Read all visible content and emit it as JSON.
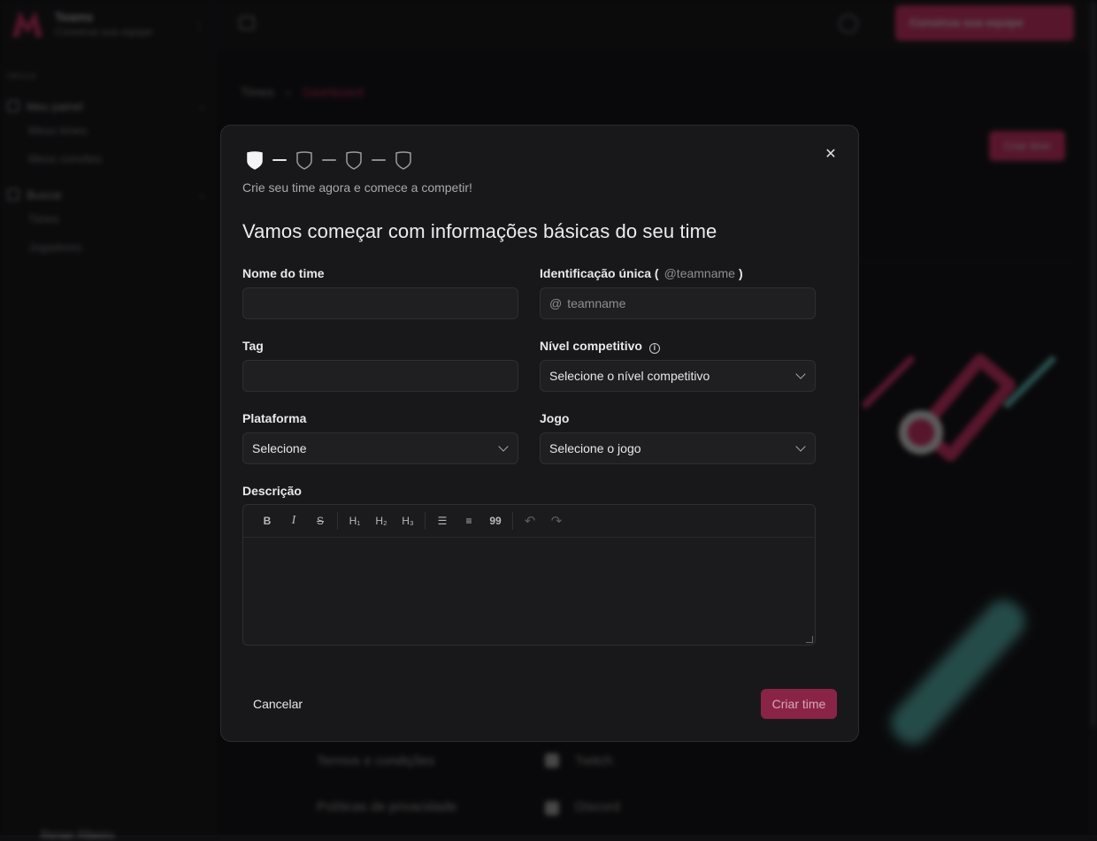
{
  "background": {
    "brand": {
      "title": "Teams",
      "subtitle": "Construa sua equipe"
    },
    "menu_label": "Menus",
    "menu_groups": [
      {
        "title": "Meu painel",
        "items": [
          "Meus times",
          "Meus convites"
        ]
      },
      {
        "title": "Buscar",
        "items": [
          "Times",
          "Jogadores"
        ]
      }
    ],
    "top_cta": "Construa sua equipe",
    "breadcrumb": [
      "Times",
      "Dashboard"
    ],
    "right_cta": "Criar time",
    "footer_links": [
      "Termos e condições",
      "Políticas de privacidade"
    ],
    "social_links": [
      "Twitch",
      "Discord"
    ],
    "user_name": "Renan Ribeiro"
  },
  "modal": {
    "subtitle": "Crie seu time agora e comece a competir!",
    "heading": "Vamos começar com informações básicas do seu time",
    "steps": [
      "step-1",
      "step-2",
      "step-3",
      "step-4"
    ],
    "fields": {
      "team_name": {
        "label": "Nome do time",
        "value": ""
      },
      "unique_id": {
        "label": "Identificação única (",
        "label_hint": "@teamname",
        "label_end": ")",
        "prefix": "@",
        "placeholder": "teamname"
      },
      "tag": {
        "label": "Tag",
        "value": ""
      },
      "competitive_level": {
        "label": "Nível competitivo",
        "value": "Selecione o nível competitivo"
      },
      "platform": {
        "label": "Plataforma",
        "value": "Selecione"
      },
      "game": {
        "label": "Jogo",
        "value": "Selecione o jogo"
      },
      "description": {
        "label": "Descrição"
      }
    },
    "toolbar": {
      "bold": "B",
      "italic": "I",
      "strike": "S",
      "h1": "H₁",
      "h2": "H₂",
      "h3": "H₃",
      "bullet": "☰",
      "ordered": "≡",
      "quote": "99",
      "undo": "↶",
      "redo": "↷"
    },
    "cancel_label": "Cancelar",
    "create_label": "Criar time",
    "colors": {
      "accent": "#e8336d",
      "create_disabled": "#8a2447"
    }
  }
}
